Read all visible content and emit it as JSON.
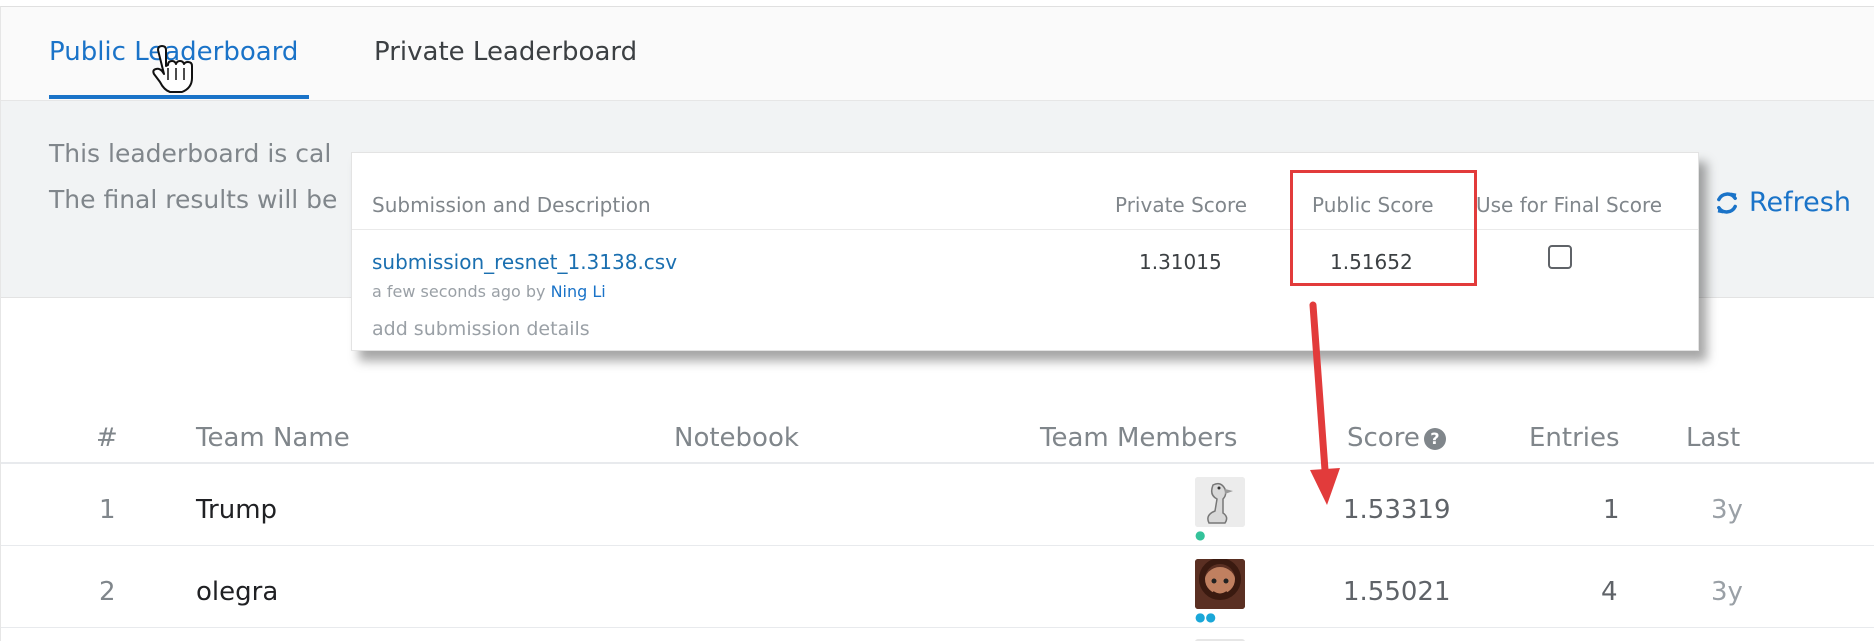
{
  "tabs": [
    {
      "label": "Public Leaderboard",
      "active": true
    },
    {
      "label": "Private Leaderboard",
      "active": false
    }
  ],
  "info": {
    "line1": "This leaderboard is cal",
    "line2": "The final results will be",
    "refresh_label": "Refresh",
    "refresh_icon": "refresh-icon"
  },
  "popup": {
    "headers": {
      "submission": "Submission and Description",
      "private_score": "Private Score",
      "public_score": "Public Score",
      "final_score": "Use for Final Score"
    },
    "submission": {
      "filename": "submission_resnet_1.3138.csv",
      "time_prefix": "a few seconds ago by",
      "author": "Ning Li",
      "add_details": "add submission details",
      "private_score": "1.31015",
      "public_score": "1.51652",
      "use_for_final": false
    }
  },
  "table": {
    "headers": {
      "rank": "#",
      "team": "Team Name",
      "notebook": "Notebook",
      "members": "Team Members",
      "score": "Score",
      "entries": "Entries",
      "last": "Last"
    },
    "rows": [
      {
        "rank": "1",
        "team": "Trump",
        "score": "1.53319",
        "entries": "1",
        "last": "3y",
        "avatar": "goose-avatar"
      },
      {
        "rank": "2",
        "team": "olegra",
        "score": "1.55021",
        "entries": "4",
        "last": "3y",
        "avatar": "portrait-avatar"
      }
    ]
  },
  "annotations": {
    "highlight_color": "#e23b3b",
    "accent_color": "#1a73c8"
  }
}
